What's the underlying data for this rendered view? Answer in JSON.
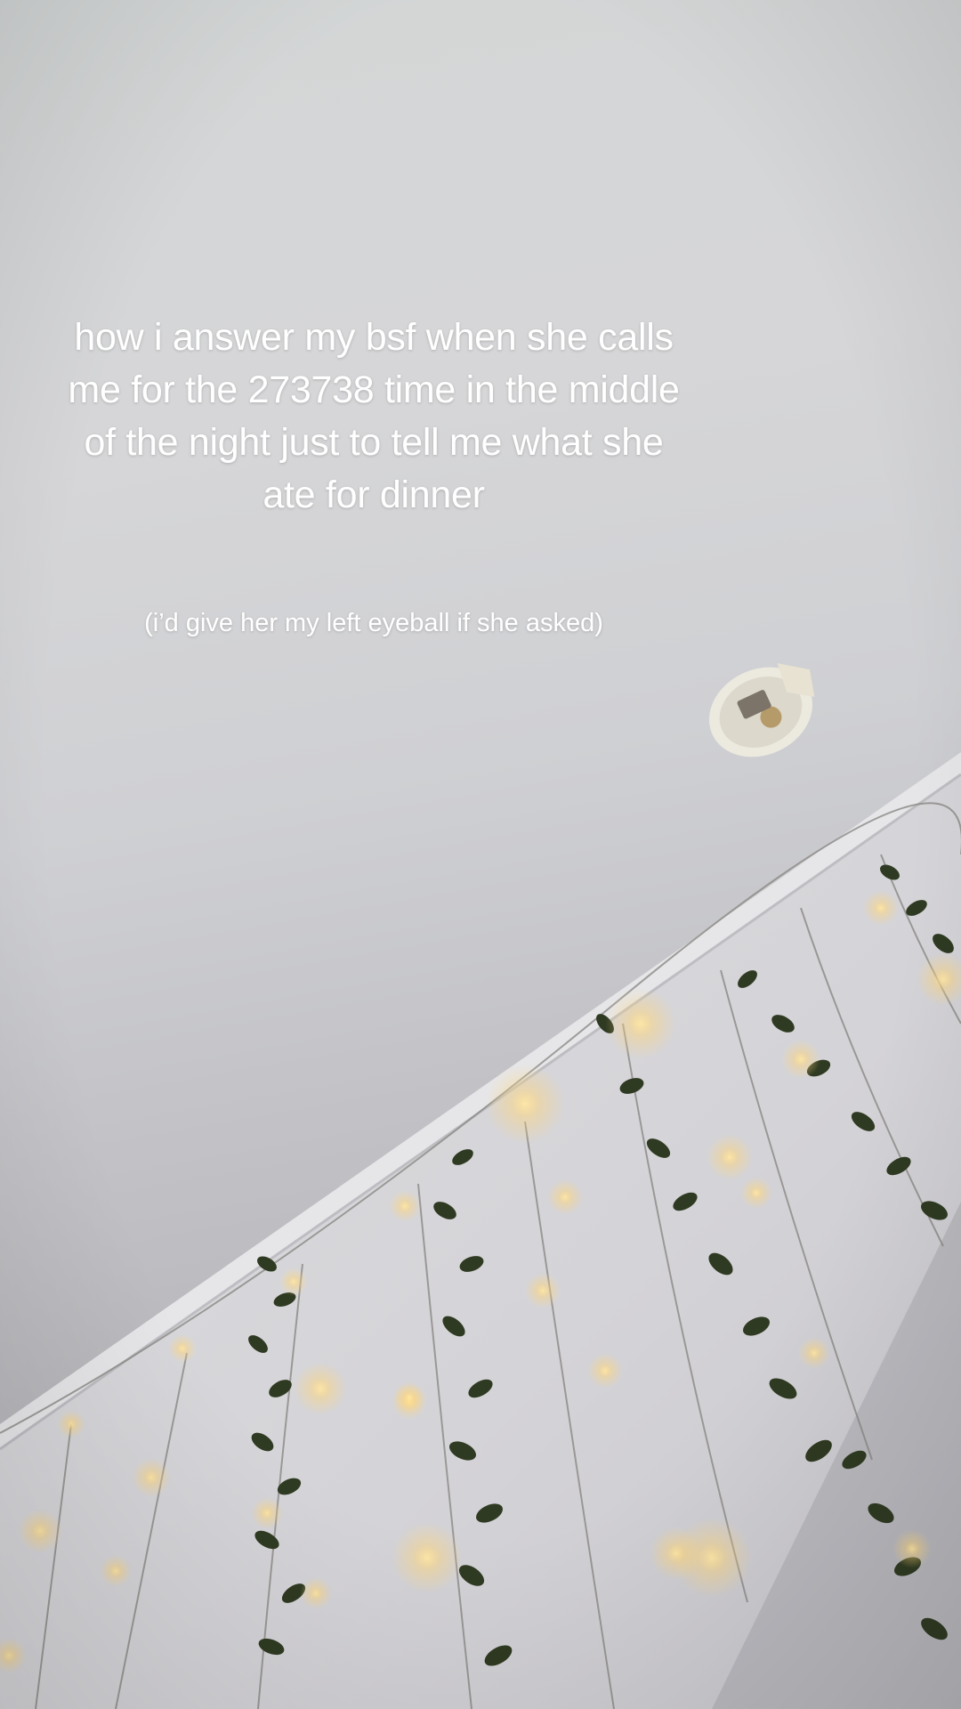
{
  "overlay": {
    "main_caption": "how i answer my bsf when she calls me for the 273738 time in the middle of the night just to tell me what she ate for dinner",
    "sub_caption": "(i’d give her my left eyeball if she asked)"
  },
  "scene": {
    "ceiling_color": "#d2d3d5",
    "wall_color": "#d9d8dc",
    "vine_color": "#2f3a22",
    "light_color": "#ffd98a"
  }
}
